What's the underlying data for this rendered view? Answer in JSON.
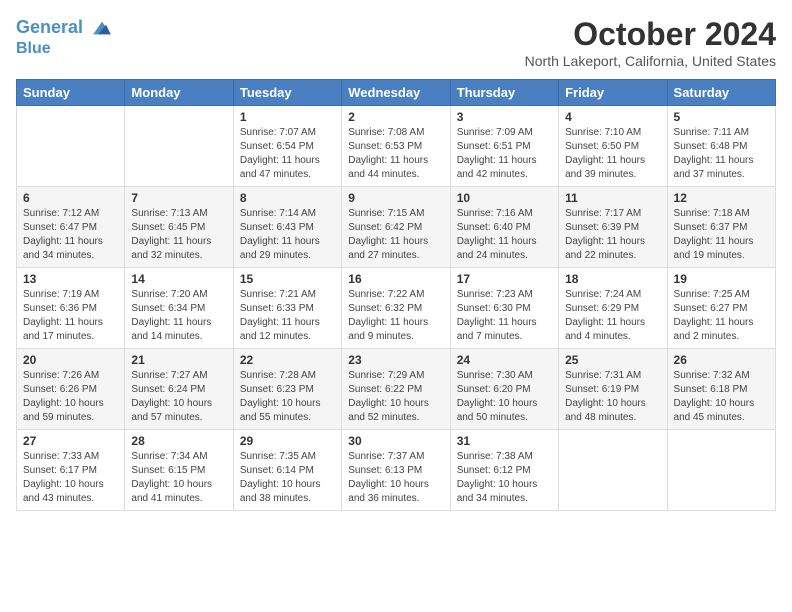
{
  "header": {
    "logo_line1": "General",
    "logo_line2": "Blue",
    "month": "October 2024",
    "location": "North Lakeport, California, United States"
  },
  "days_of_week": [
    "Sunday",
    "Monday",
    "Tuesday",
    "Wednesday",
    "Thursday",
    "Friday",
    "Saturday"
  ],
  "weeks": [
    [
      {
        "day": "",
        "info": ""
      },
      {
        "day": "",
        "info": ""
      },
      {
        "day": "1",
        "info": "Sunrise: 7:07 AM\nSunset: 6:54 PM\nDaylight: 11 hours and 47 minutes."
      },
      {
        "day": "2",
        "info": "Sunrise: 7:08 AM\nSunset: 6:53 PM\nDaylight: 11 hours and 44 minutes."
      },
      {
        "day": "3",
        "info": "Sunrise: 7:09 AM\nSunset: 6:51 PM\nDaylight: 11 hours and 42 minutes."
      },
      {
        "day": "4",
        "info": "Sunrise: 7:10 AM\nSunset: 6:50 PM\nDaylight: 11 hours and 39 minutes."
      },
      {
        "day": "5",
        "info": "Sunrise: 7:11 AM\nSunset: 6:48 PM\nDaylight: 11 hours and 37 minutes."
      }
    ],
    [
      {
        "day": "6",
        "info": "Sunrise: 7:12 AM\nSunset: 6:47 PM\nDaylight: 11 hours and 34 minutes."
      },
      {
        "day": "7",
        "info": "Sunrise: 7:13 AM\nSunset: 6:45 PM\nDaylight: 11 hours and 32 minutes."
      },
      {
        "day": "8",
        "info": "Sunrise: 7:14 AM\nSunset: 6:43 PM\nDaylight: 11 hours and 29 minutes."
      },
      {
        "day": "9",
        "info": "Sunrise: 7:15 AM\nSunset: 6:42 PM\nDaylight: 11 hours and 27 minutes."
      },
      {
        "day": "10",
        "info": "Sunrise: 7:16 AM\nSunset: 6:40 PM\nDaylight: 11 hours and 24 minutes."
      },
      {
        "day": "11",
        "info": "Sunrise: 7:17 AM\nSunset: 6:39 PM\nDaylight: 11 hours and 22 minutes."
      },
      {
        "day": "12",
        "info": "Sunrise: 7:18 AM\nSunset: 6:37 PM\nDaylight: 11 hours and 19 minutes."
      }
    ],
    [
      {
        "day": "13",
        "info": "Sunrise: 7:19 AM\nSunset: 6:36 PM\nDaylight: 11 hours and 17 minutes."
      },
      {
        "day": "14",
        "info": "Sunrise: 7:20 AM\nSunset: 6:34 PM\nDaylight: 11 hours and 14 minutes."
      },
      {
        "day": "15",
        "info": "Sunrise: 7:21 AM\nSunset: 6:33 PM\nDaylight: 11 hours and 12 minutes."
      },
      {
        "day": "16",
        "info": "Sunrise: 7:22 AM\nSunset: 6:32 PM\nDaylight: 11 hours and 9 minutes."
      },
      {
        "day": "17",
        "info": "Sunrise: 7:23 AM\nSunset: 6:30 PM\nDaylight: 11 hours and 7 minutes."
      },
      {
        "day": "18",
        "info": "Sunrise: 7:24 AM\nSunset: 6:29 PM\nDaylight: 11 hours and 4 minutes."
      },
      {
        "day": "19",
        "info": "Sunrise: 7:25 AM\nSunset: 6:27 PM\nDaylight: 11 hours and 2 minutes."
      }
    ],
    [
      {
        "day": "20",
        "info": "Sunrise: 7:26 AM\nSunset: 6:26 PM\nDaylight: 10 hours and 59 minutes."
      },
      {
        "day": "21",
        "info": "Sunrise: 7:27 AM\nSunset: 6:24 PM\nDaylight: 10 hours and 57 minutes."
      },
      {
        "day": "22",
        "info": "Sunrise: 7:28 AM\nSunset: 6:23 PM\nDaylight: 10 hours and 55 minutes."
      },
      {
        "day": "23",
        "info": "Sunrise: 7:29 AM\nSunset: 6:22 PM\nDaylight: 10 hours and 52 minutes."
      },
      {
        "day": "24",
        "info": "Sunrise: 7:30 AM\nSunset: 6:20 PM\nDaylight: 10 hours and 50 minutes."
      },
      {
        "day": "25",
        "info": "Sunrise: 7:31 AM\nSunset: 6:19 PM\nDaylight: 10 hours and 48 minutes."
      },
      {
        "day": "26",
        "info": "Sunrise: 7:32 AM\nSunset: 6:18 PM\nDaylight: 10 hours and 45 minutes."
      }
    ],
    [
      {
        "day": "27",
        "info": "Sunrise: 7:33 AM\nSunset: 6:17 PM\nDaylight: 10 hours and 43 minutes."
      },
      {
        "day": "28",
        "info": "Sunrise: 7:34 AM\nSunset: 6:15 PM\nDaylight: 10 hours and 41 minutes."
      },
      {
        "day": "29",
        "info": "Sunrise: 7:35 AM\nSunset: 6:14 PM\nDaylight: 10 hours and 38 minutes."
      },
      {
        "day": "30",
        "info": "Sunrise: 7:37 AM\nSunset: 6:13 PM\nDaylight: 10 hours and 36 minutes."
      },
      {
        "day": "31",
        "info": "Sunrise: 7:38 AM\nSunset: 6:12 PM\nDaylight: 10 hours and 34 minutes."
      },
      {
        "day": "",
        "info": ""
      },
      {
        "day": "",
        "info": ""
      }
    ]
  ]
}
